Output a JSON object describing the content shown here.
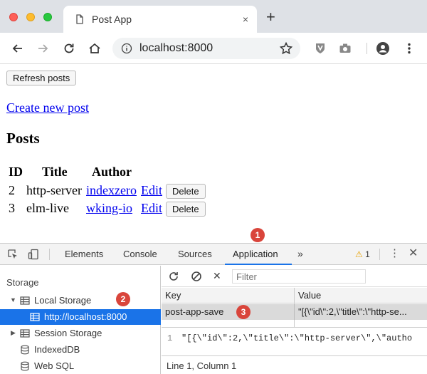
{
  "browser": {
    "tab_title": "Post App",
    "tab_close": "×",
    "new_tab": "+",
    "url": "localhost:8000"
  },
  "page": {
    "refresh_label": "Refresh posts",
    "create_link": "Create new post",
    "heading": "Posts",
    "table": {
      "columns": [
        "ID",
        "Title",
        "Author"
      ],
      "rows": [
        {
          "id": "2",
          "title": "http-server",
          "author": "indexzero",
          "edit": "Edit",
          "delete": "Delete"
        },
        {
          "id": "3",
          "title": "elm-live",
          "author": "wking-io",
          "edit": "Edit",
          "delete": "Delete"
        }
      ]
    }
  },
  "badges": [
    "1",
    "2",
    "3"
  ],
  "devtools": {
    "tabs": [
      "Elements",
      "Console",
      "Sources",
      "Application"
    ],
    "active_tab": "Application",
    "more": "»",
    "warning_count": "1",
    "warn_glyph": "⚠",
    "kebab": "⋮",
    "close": "✕",
    "sidebar": {
      "section": "Storage",
      "items": [
        {
          "label": "Local Storage",
          "arrow": "▼"
        },
        {
          "label": "http://localhost:8000"
        },
        {
          "label": "Session Storage",
          "arrow": "▶"
        },
        {
          "label": "IndexedDB"
        },
        {
          "label": "Web SQL"
        }
      ]
    },
    "filter_placeholder": "Filter",
    "clear_glyph": "✕",
    "grid": {
      "columns": [
        "Key",
        "Value"
      ],
      "rows": [
        {
          "key": "post-app-save",
          "value": "\"[{\\\"id\\\":2,\\\"title\\\":\\\"http-se..."
        }
      ]
    },
    "preview": {
      "line_number": "1",
      "text": "\"[{\\\"id\\\":2,\\\"title\\\":\\\"http-server\\\",\\\"autho"
    },
    "status": "Line 1, Column 1"
  },
  "colors": {
    "accent": "#1a73e8",
    "badge": "#d9453b",
    "link": "#0000ee"
  }
}
